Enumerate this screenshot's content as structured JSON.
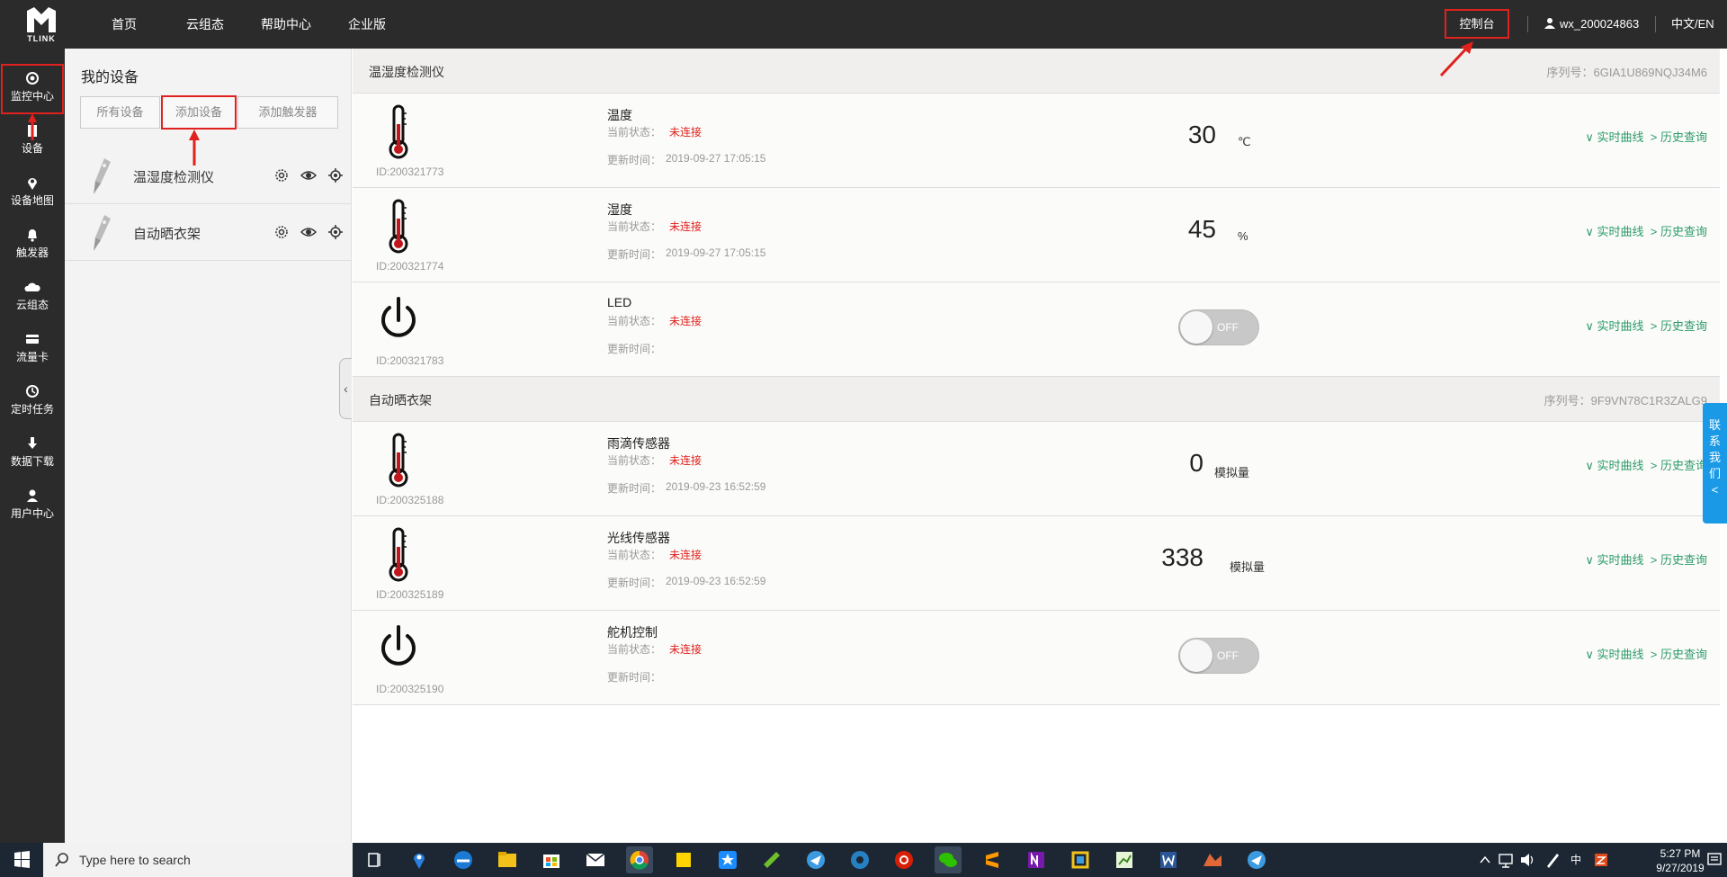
{
  "header": {
    "logo_text": "TLINK",
    "nav": [
      "首页",
      "云组态",
      "帮助中心",
      "企业版"
    ],
    "console": "控制台",
    "user": "wx_200024863",
    "lang": "中文/EN"
  },
  "sidebar": {
    "items": [
      {
        "label": "监控中心",
        "icon": "monitor-icon"
      },
      {
        "label": "设备",
        "icon": "device-icon"
      },
      {
        "label": "设备地图",
        "icon": "map-pin-icon"
      },
      {
        "label": "触发器",
        "icon": "bell-icon"
      },
      {
        "label": "云组态",
        "icon": "cloud-icon"
      },
      {
        "label": "流量卡",
        "icon": "card-icon"
      },
      {
        "label": "定时任务",
        "icon": "clock-icon"
      },
      {
        "label": "数据下载",
        "icon": "download-icon"
      },
      {
        "label": "用户中心",
        "icon": "user-icon"
      }
    ]
  },
  "devices_panel": {
    "title": "我的设备",
    "tabs": [
      "所有设备",
      "添加设备",
      "添加触发器"
    ],
    "devices": [
      {
        "name": "温湿度检测仪"
      },
      {
        "name": "自动晒衣架"
      }
    ]
  },
  "groups": [
    {
      "name": "温湿度检测仪",
      "serial": "序列号：6GIA1U869NQJ34M6",
      "sensors": [
        {
          "name": "温度",
          "id": "ID:200321773",
          "status_label": "当前状态：",
          "status": "未连接",
          "updated_label": "更新时间：",
          "updated": "2019-09-27 17:05:15",
          "value": "30",
          "unit": "℃",
          "type": "thermometer"
        },
        {
          "name": "湿度",
          "id": "ID:200321774",
          "status_label": "当前状态：",
          "status": "未连接",
          "updated_label": "更新时间：",
          "updated": "2019-09-27 17:05:15",
          "value": "45",
          "unit": "%",
          "type": "thermometer"
        },
        {
          "name": "LED",
          "id": "ID:200321783",
          "status_label": "当前状态：",
          "status": "未连接",
          "updated_label": "更新时间：",
          "updated": "",
          "toggle": "OFF",
          "type": "switch"
        }
      ]
    },
    {
      "name": "自动晒衣架",
      "serial": "序列号：9F9VN78C1R3ZALG9",
      "sensors": [
        {
          "name": "雨滴传感器",
          "id": "ID:200325188",
          "status_label": "当前状态：",
          "status": "未连接",
          "updated_label": "更新时间：",
          "updated": "2019-09-23 16:52:59",
          "value": "0",
          "unit": "模拟量",
          "type": "thermometer"
        },
        {
          "name": "光线传感器",
          "id": "ID:200325189",
          "status_label": "当前状态：",
          "status": "未连接",
          "updated_label": "更新时间：",
          "updated": "2019-09-23 16:52:59",
          "value": "338",
          "unit": "模拟量",
          "type": "thermometer"
        },
        {
          "name": "舵机控制",
          "id": "ID:200325190",
          "status_label": "当前状态：",
          "status": "未连接",
          "updated_label": "更新时间：",
          "updated": "",
          "toggle": "OFF",
          "type": "switch"
        }
      ]
    }
  ],
  "links": {
    "realtime": "∨ 实时曲线",
    "history": "> 历史查询"
  },
  "contact": "联系我们<",
  "taskbar": {
    "search_placeholder": "Type here to search",
    "time": "5:27 PM",
    "date": "9/27/2019",
    "ime": "中"
  },
  "colors": {
    "accent_green": "#2d9b6a",
    "status_red": "#e0211d",
    "dark_bg": "#2b2b2b",
    "contact_blue": "#1a9ae6"
  }
}
